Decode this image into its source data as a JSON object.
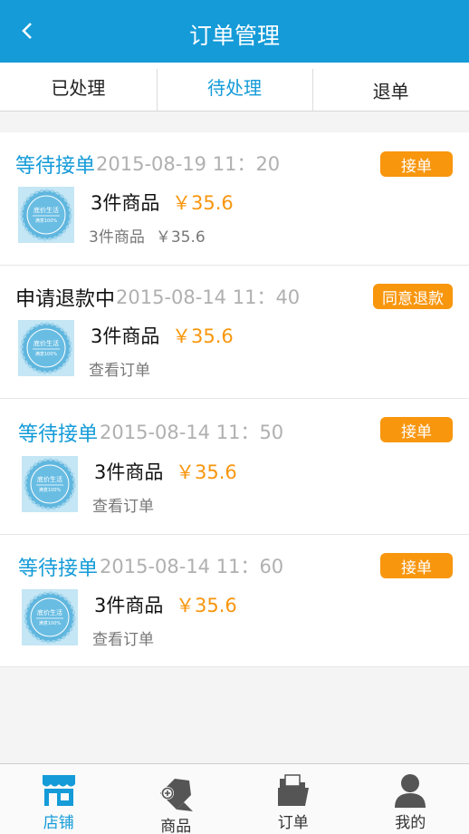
{
  "header": {
    "title": "订单管理"
  },
  "tabs": [
    {
      "label": "已处理",
      "active": false
    },
    {
      "label": "待处理",
      "active": true
    },
    {
      "label": "退单",
      "active": false
    }
  ],
  "orders": [
    {
      "status": "等待接单",
      "time": "2015-08-19 11：20",
      "action": "接单",
      "count": "3件商品",
      "price": "￥35.6",
      "sub_count": "3件商品",
      "sub_price": "￥35.6",
      "sub_link": ""
    },
    {
      "status": "申请退款中",
      "time": "2015-08-14 11：40",
      "action": "同意退款",
      "count": "3件商品",
      "price": "￥35.6",
      "sub_link": "查看订单"
    },
    {
      "status": "等待接单",
      "time": "2015-08-14 11：50",
      "action": "接单",
      "count": "3件商品",
      "price": "￥35.6",
      "sub_link": "查看订单"
    },
    {
      "status": "等待接单",
      "time": "2015-08-14 11：60",
      "action": "接单",
      "count": "3件商品",
      "price": "￥35.6",
      "sub_link": "查看订单"
    }
  ],
  "thumb": {
    "line1": "底价生活",
    "line2": "满意100%"
  },
  "nav": [
    {
      "label": "店铺",
      "icon": "store-icon",
      "active": true
    },
    {
      "label": "商品",
      "icon": "goods-tag-icon",
      "active": false
    },
    {
      "label": "订单",
      "icon": "folder-icon",
      "active": false
    },
    {
      "label": "我的",
      "icon": "user-icon",
      "active": false
    }
  ],
  "colors": {
    "brand": "#149bd8",
    "accent": "#f8960e"
  }
}
